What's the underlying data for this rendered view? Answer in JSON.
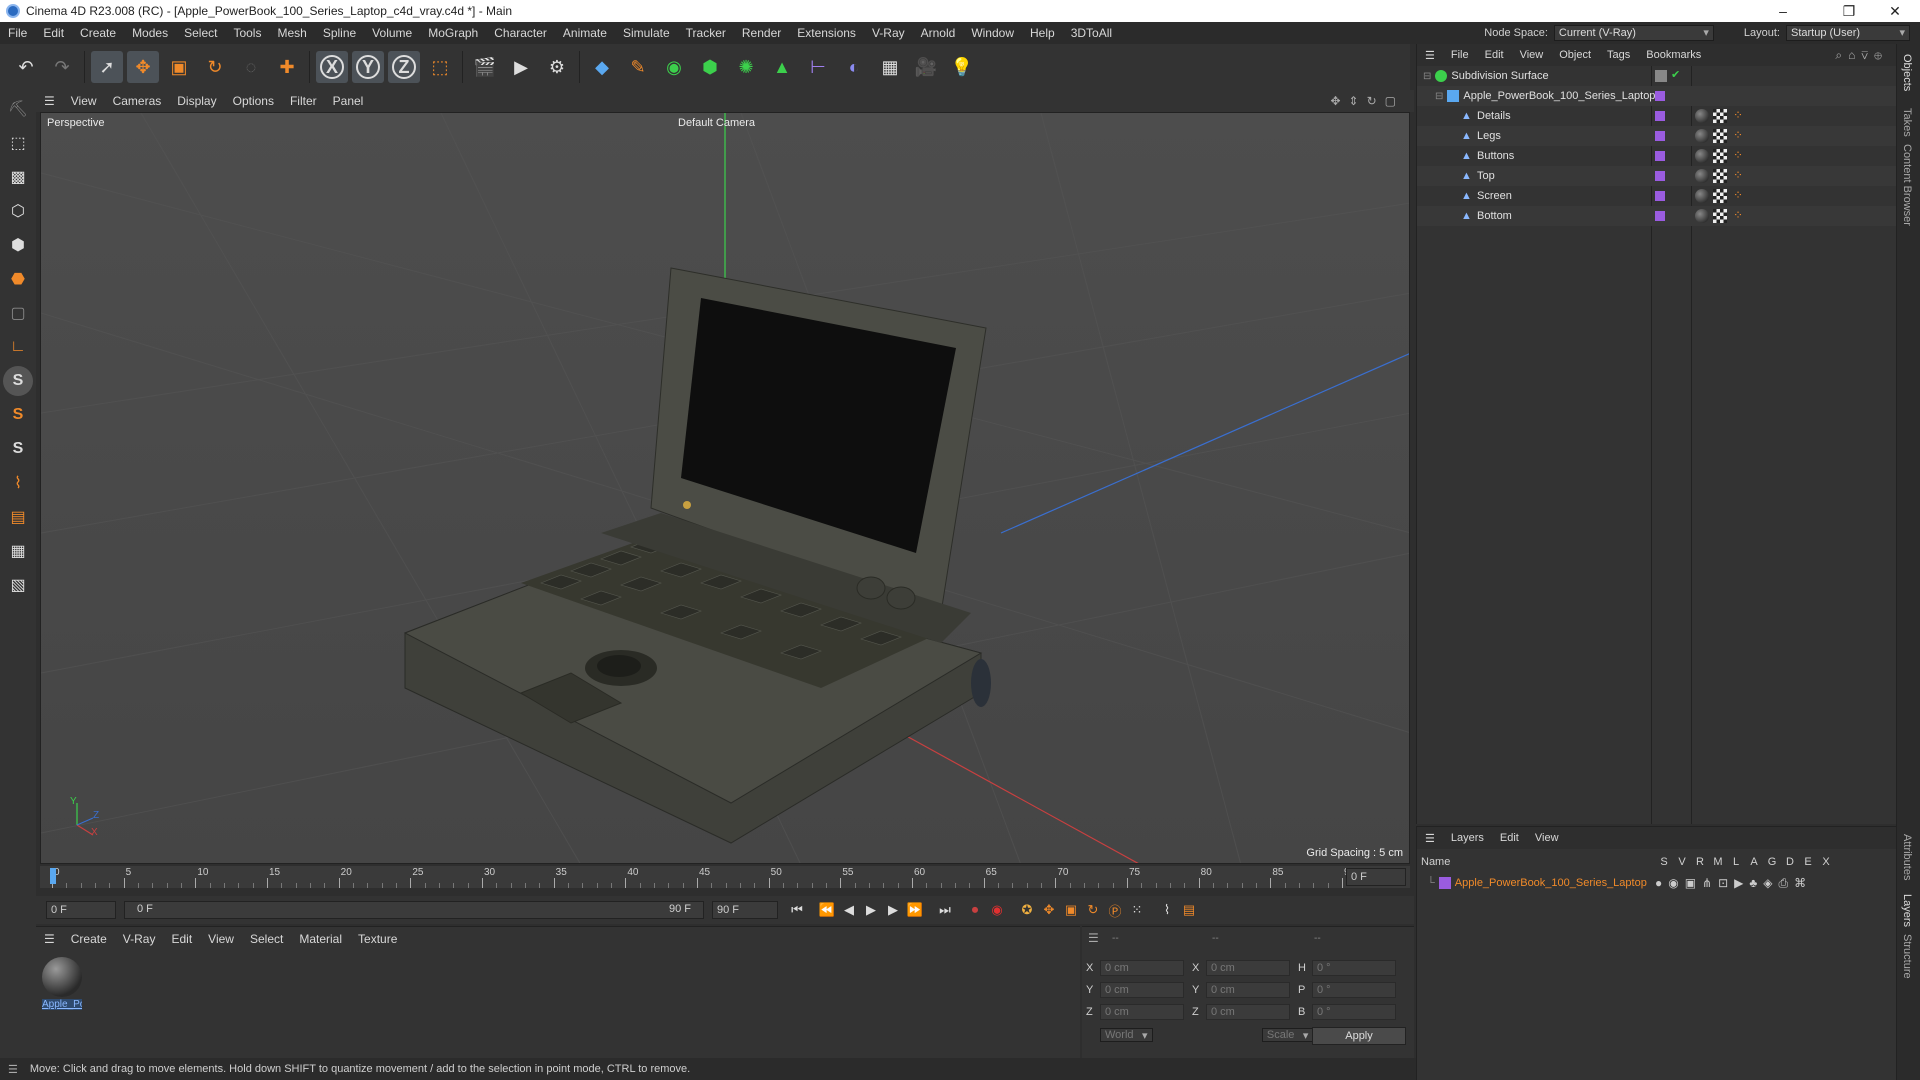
{
  "window": {
    "title": "Cinema 4D R23.008 (RC) - [Apple_PowerBook_100_Series_Laptop_c4d_vray.c4d *] - Main",
    "minimize": "–",
    "maximize": "❐",
    "close": "✕"
  },
  "menubar": {
    "items": [
      "File",
      "Edit",
      "Create",
      "Modes",
      "Select",
      "Tools",
      "Mesh",
      "Spline",
      "Volume",
      "MoGraph",
      "Character",
      "Animate",
      "Simulate",
      "Tracker",
      "Render",
      "Extensions",
      "V-Ray",
      "Arnold",
      "Window",
      "Help",
      "3DToAll"
    ],
    "node_space_label": "Node Space:",
    "node_space_value": "Current (V-Ray)",
    "layout_label": "Layout:",
    "layout_value": "Startup (User)"
  },
  "toolbar": {
    "icons": [
      "undo-icon",
      "redo-icon",
      "select-icon",
      "move-icon",
      "scale-icon",
      "rotate-icon",
      "live-select-icon",
      "create-icon",
      "x-axis-icon",
      "y-axis-icon",
      "z-axis-icon",
      "coordinate-icon",
      "render-region-icon",
      "render-view-icon",
      "render-settings-icon",
      "cube-icon",
      "pen-icon",
      "subdivision-icon",
      "extrude-icon",
      "cloner-icon",
      "mograph-icon",
      "deformer-icon",
      "field-icon",
      "floor-icon",
      "camera-icon",
      "light-icon"
    ],
    "axis_x": "X",
    "axis_y": "Y",
    "axis_z": "Z"
  },
  "viewport": {
    "menu": [
      "View",
      "Cameras",
      "Display",
      "Options",
      "Filter",
      "Panel"
    ],
    "projection": "Perspective",
    "camera": "Default Camera",
    "grid_spacing": "Grid Spacing : 5 cm",
    "axis_y": "Y",
    "axis_z": "Z",
    "axis_x": "X"
  },
  "timeline": {
    "ticks": [
      "0",
      "5",
      "10",
      "15",
      "20",
      "25",
      "30",
      "35",
      "40",
      "45",
      "50",
      "55",
      "60",
      "65",
      "70",
      "75",
      "80",
      "85",
      "90"
    ],
    "frame_end_field": "0 F",
    "current_frame": "0 F",
    "range_start": "0 F",
    "range_end": "90 F",
    "max_frame": "90 F"
  },
  "material_panel": {
    "menu": [
      "Create",
      "V-Ray",
      "Edit",
      "View",
      "Select",
      "Material",
      "Texture"
    ],
    "materials": [
      {
        "label": "Apple_Po"
      }
    ]
  },
  "coord_panel": {
    "headers": [
      "--",
      "--",
      "--"
    ],
    "rows": [
      {
        "a": "X",
        "av": "0 cm",
        "b": "X",
        "bv": "0 cm",
        "c": "H",
        "cv": "0 °"
      },
      {
        "a": "Y",
        "av": "0 cm",
        "b": "Y",
        "bv": "0 cm",
        "c": "P",
        "cv": "0 °"
      },
      {
        "a": "Z",
        "av": "0 cm",
        "b": "Z",
        "bv": "0 cm",
        "c": "B",
        "cv": "0 °"
      }
    ],
    "coord_mode": "World",
    "size_mode": "Scale",
    "apply": "Apply"
  },
  "status": {
    "text": "Move: Click and drag to move elements. Hold down SHIFT to quantize movement / add to the selection in point mode, CTRL to remove."
  },
  "objects_panel": {
    "menu": [
      "File",
      "Edit",
      "View",
      "Object",
      "Tags",
      "Bookmarks"
    ],
    "items": [
      {
        "name": "Subdivision Surface",
        "level": 0
      },
      {
        "name": "Apple_PowerBook_100_Series_Laptop",
        "level": 1
      },
      {
        "name": "Details",
        "level": 2
      },
      {
        "name": "Legs",
        "level": 2
      },
      {
        "name": "Buttons",
        "level": 2
      },
      {
        "name": "Top",
        "level": 2
      },
      {
        "name": "Screen",
        "level": 2
      },
      {
        "name": "Bottom",
        "level": 2
      }
    ]
  },
  "layers_panel": {
    "menu": [
      "Layers",
      "Edit",
      "View"
    ],
    "name_header": "Name",
    "flags": [
      "S",
      "V",
      "R",
      "M",
      "L",
      "A",
      "G",
      "D",
      "E",
      "X"
    ],
    "layers": [
      {
        "name": "Apple_PowerBook_100_Series_Laptop",
        "color": "#9a5ce0"
      }
    ]
  },
  "side_tabs": [
    "Objects",
    "Takes",
    "Content Browser",
    "Attributes",
    "Layers",
    "Structure"
  ],
  "colors": {
    "accent_orange": "#f08a2a",
    "layer_purple": "#9a5ce0",
    "y_axis_green": "#3cd04c",
    "x_axis_red": "#c84040",
    "z_axis_blue": "#3a6fd0"
  }
}
